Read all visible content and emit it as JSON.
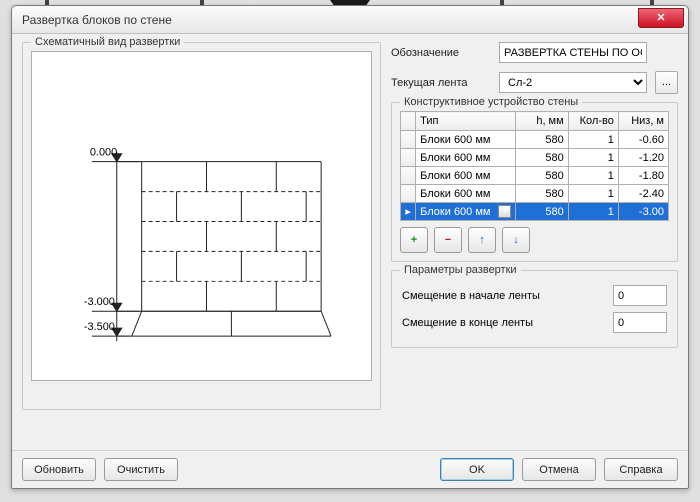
{
  "window": {
    "title": "Развертка блоков по стене"
  },
  "schematic": {
    "legend": "Схематичный вид развертки",
    "marks": {
      "top": "0.000",
      "mid": "-3.000",
      "bottom": "-3.500"
    }
  },
  "right": {
    "designation": {
      "label": "Обозначение",
      "value": "РАЗВЕРТКА СТЕНЫ ПО ОСИ"
    },
    "tape": {
      "label": "Текущая лента",
      "value": "Сл-2",
      "more": "..."
    },
    "wall_group": {
      "legend": "Конструктивное устройство стены"
    },
    "table": {
      "headers": {
        "type": "Тип",
        "h": "h, мм",
        "qty": "Кол-во",
        "low": "Низ, м"
      },
      "rows": [
        {
          "type": "Блоки 600 мм",
          "h": "580",
          "qty": "1",
          "low": "-0.60",
          "selected": false
        },
        {
          "type": "Блоки 600 мм",
          "h": "580",
          "qty": "1",
          "low": "-1.20",
          "selected": false
        },
        {
          "type": "Блоки 600 мм",
          "h": "580",
          "qty": "1",
          "low": "-1.80",
          "selected": false
        },
        {
          "type": "Блоки 600 мм",
          "h": "580",
          "qty": "1",
          "low": "-2.40",
          "selected": false
        },
        {
          "type": "Блоки 600 мм",
          "h": "580",
          "qty": "1",
          "low": "-3.00",
          "selected": true
        }
      ],
      "marker": "▸"
    },
    "buttons": {
      "add": "+",
      "remove": "−",
      "up": "↑",
      "down": "↓"
    },
    "params": {
      "legend": "Параметры развертки",
      "start": {
        "label": "Смещение в начале ленты",
        "value": "0"
      },
      "end": {
        "label": "Смещение в конце ленты",
        "value": "0"
      }
    }
  },
  "footer": {
    "update": "Обновить",
    "clear": "Очистить",
    "ok": "OK",
    "cancel": "Отмена",
    "help": "Справка"
  }
}
